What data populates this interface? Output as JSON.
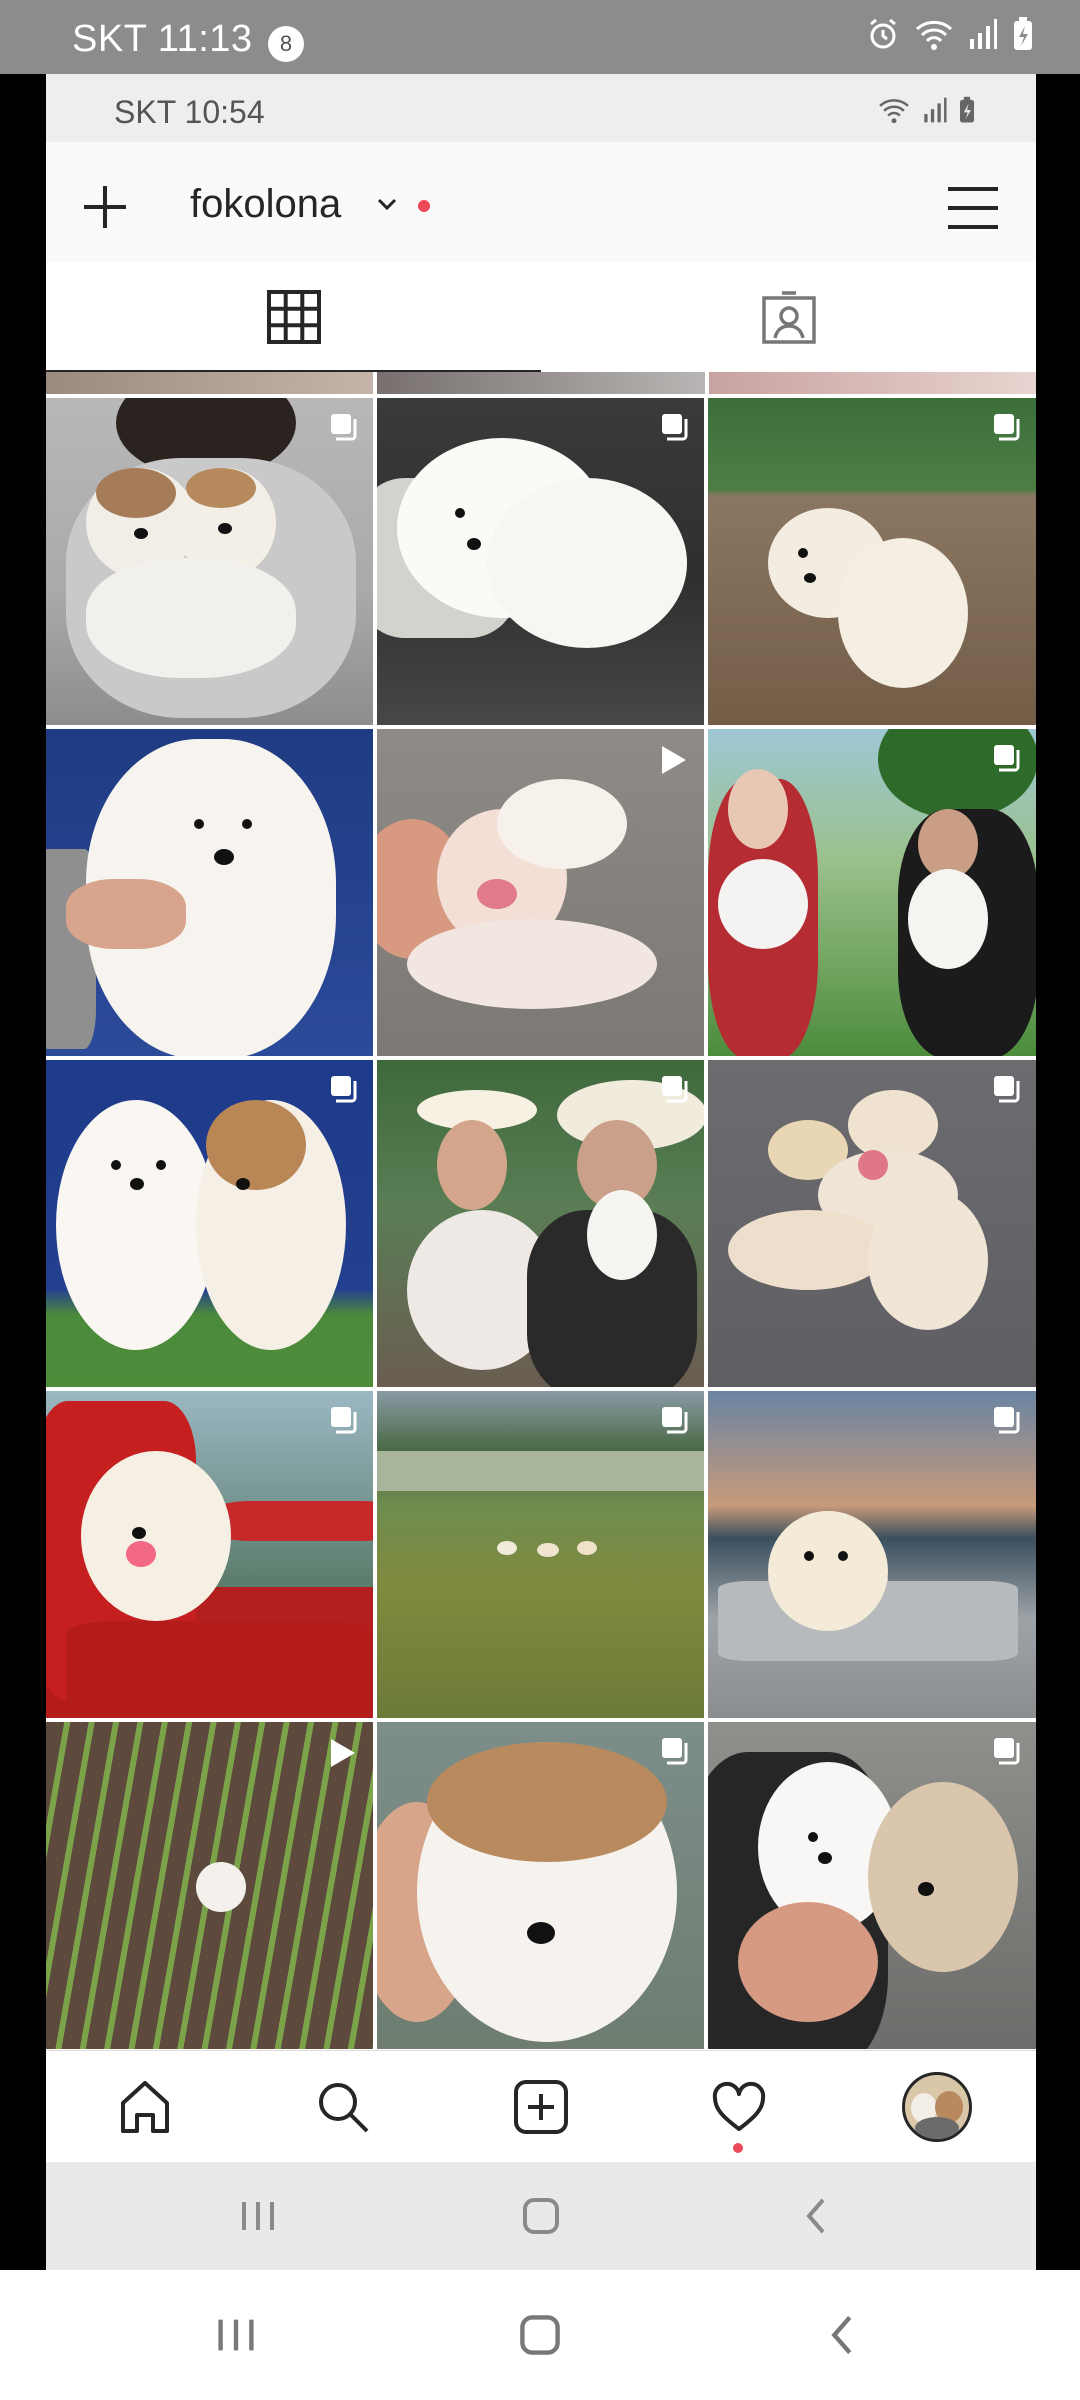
{
  "outer_status": {
    "time": "SKT 11:13",
    "notification_count": "8",
    "icons": [
      "alarm-icon",
      "wifi-icon",
      "signal-icon",
      "battery-charging-icon"
    ]
  },
  "inner_status": {
    "time": "SKT 10:54",
    "icons": [
      "wifi-icon",
      "signal-icon",
      "battery-charging-icon"
    ]
  },
  "header": {
    "username": "fokolona",
    "add_icon": "plus-icon",
    "menu_icon": "hamburger-icon",
    "has_notification_dot": true
  },
  "profile_tabs": [
    {
      "name": "grid",
      "icon": "grid-icon",
      "active": true
    },
    {
      "name": "tagged",
      "icon": "tagged-person-icon",
      "active": false
    }
  ],
  "posts": [
    {
      "subject": "two puppies held on lap",
      "type": "carousel"
    },
    {
      "subject": "white puppy on leather sofa",
      "type": "carousel"
    },
    {
      "subject": "fluffy puppy on dirt near plants",
      "type": "carousel"
    },
    {
      "subject": "white puppy held in arms",
      "type": "image"
    },
    {
      "subject": "newborn puppies on carpet",
      "type": "video"
    },
    {
      "subject": "two women holding puppies",
      "type": "carousel"
    },
    {
      "subject": "two puppies held together",
      "type": "carousel"
    },
    {
      "subject": "women in sun hats with puppies",
      "type": "carousel"
    },
    {
      "subject": "litter of puppies on gravel",
      "type": "carousel"
    },
    {
      "subject": "puppy on red plastic chair",
      "type": "carousel"
    },
    {
      "subject": "puppies on grass field",
      "type": "carousel"
    },
    {
      "subject": "puppy on truck bed at sunset",
      "type": "carousel"
    },
    {
      "subject": "puppy in vegetable field",
      "type": "video"
    },
    {
      "subject": "brown and white puppy in hand",
      "type": "carousel"
    },
    {
      "subject": "two puppies held by person",
      "type": "carousel"
    }
  ],
  "bottom_nav": [
    {
      "name": "home",
      "icon": "home-icon"
    },
    {
      "name": "search",
      "icon": "search-icon"
    },
    {
      "name": "new-post",
      "icon": "add-post-icon"
    },
    {
      "name": "activity",
      "icon": "heart-icon"
    },
    {
      "name": "profile",
      "icon": "avatar"
    }
  ],
  "system_nav": [
    "recents-icon",
    "home-button-icon",
    "back-icon"
  ],
  "colors": {
    "accent_dot": "#ed4956",
    "text": "#262626",
    "outer_status_bg": "#8c8c8c"
  }
}
